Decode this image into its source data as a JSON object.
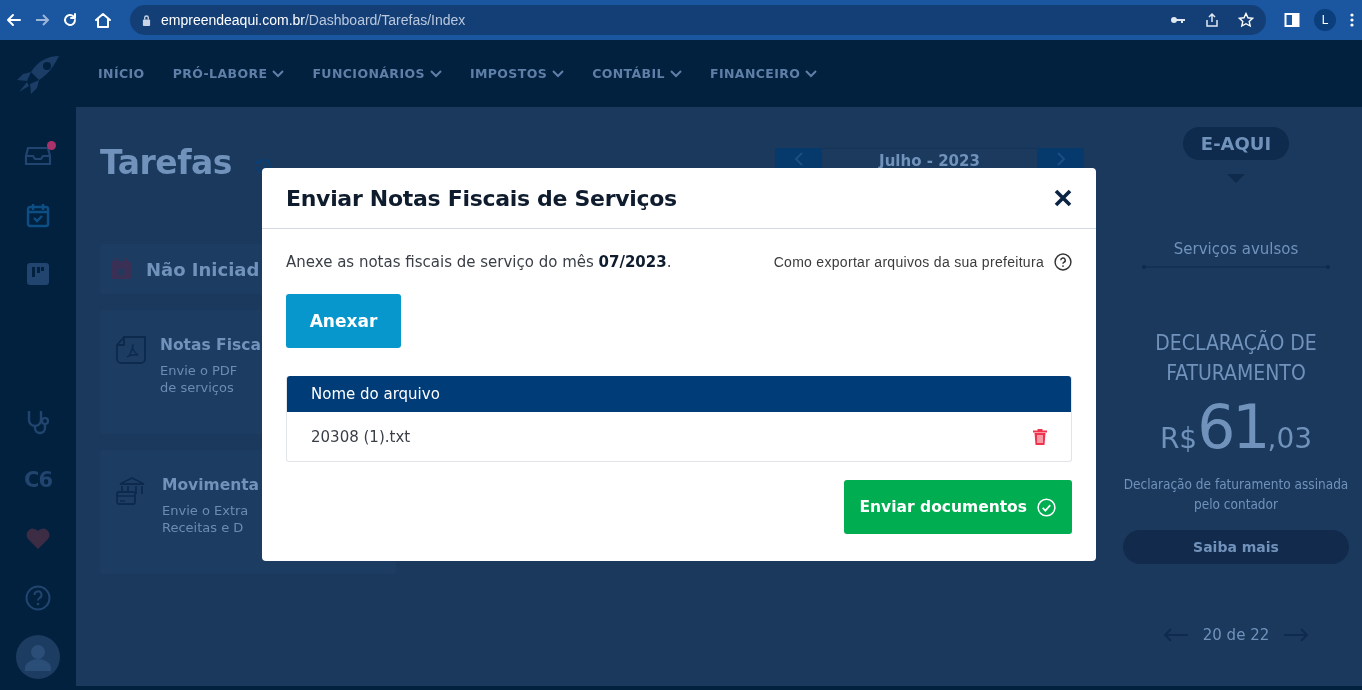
{
  "browser": {
    "url_host": "empreendeaqui.com.br",
    "url_path": "/Dashboard/Tarefas/Index",
    "profile_initial": "L"
  },
  "sidebar": {
    "items": [
      {
        "kind": "inbox",
        "notification": true
      },
      {
        "kind": "calendar",
        "notification": false
      },
      {
        "kind": "board",
        "notification": false
      },
      {
        "kind": "stethoscope",
        "notification": false
      },
      {
        "kind": "text",
        "label": "C6",
        "notification": false
      },
      {
        "kind": "heart",
        "notification": false
      },
      {
        "kind": "help",
        "notification": false
      },
      {
        "kind": "avatar",
        "notification": false
      }
    ]
  },
  "nav": {
    "items": [
      {
        "label": "INÍCIO",
        "has_menu": false
      },
      {
        "label": "PRÓ-LABORE",
        "has_menu": true
      },
      {
        "label": "FUNCIONÁRIOS",
        "has_menu": true
      },
      {
        "label": "IMPOSTOS",
        "has_menu": true
      },
      {
        "label": "CONTÁBIL",
        "has_menu": true
      },
      {
        "label": "FINANCEIRO",
        "has_menu": true
      }
    ]
  },
  "page": {
    "title": "Tarefas",
    "month": "Julho - 2023",
    "status_label": "Não Iniciad",
    "tasks": [
      {
        "kind": "pdf",
        "title": "Notas Fisca",
        "lines": [
          "Envie o PDF",
          "de serviços"
        ]
      },
      {
        "kind": "bank",
        "title": "Movimenta",
        "lines": [
          "Envie o Extra",
          "Receitas e D"
        ]
      }
    ]
  },
  "promo": {
    "brand": "E-AQUI",
    "category": "Serviços avulsos",
    "title": "DECLARAÇÃO DE FATURAMENTO",
    "currency": "R$",
    "price_int": "61",
    "price_cents": ",03",
    "description": "Declaração de faturamento assinada pelo contador",
    "cta": "Saiba mais",
    "pager": "20 de 22"
  },
  "modal": {
    "title": "Enviar Notas Fiscais de Serviços",
    "intro": "Anexe as notas fiscais de serviço do mês **07/2023**.",
    "help_link": "Como exportar arquivos da sua prefeitura",
    "attach_button": "Anexar",
    "table": {
      "columns": [
        "Nome do arquivo"
      ],
      "rows": [
        {
          "name": "20308 (1).txt"
        }
      ]
    },
    "submit_button": "Enviar documentos"
  }
}
